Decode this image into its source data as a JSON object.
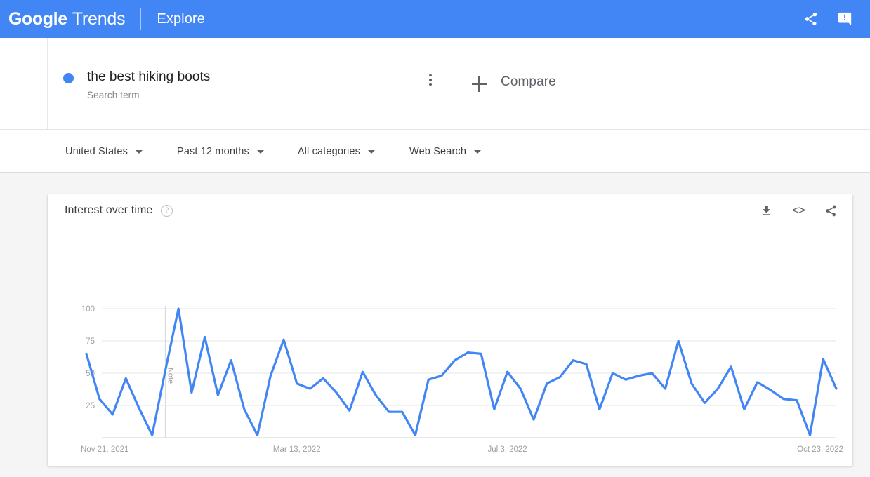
{
  "appbar": {
    "brand_google": "Google",
    "brand_trends": "Trends",
    "explore": "Explore",
    "share_icon": "share-icon",
    "feedback_icon": "feedback-icon"
  },
  "query": {
    "term": "the best hiking boots",
    "type_label": "Search term",
    "menu_icon": "more-vert-icon",
    "dot_color": "#4285f4",
    "compare_label": "Compare",
    "compare_icon": "plus-icon"
  },
  "filters": [
    {
      "label": "United States",
      "name": "filter-location"
    },
    {
      "label": "Past 12 months",
      "name": "filter-time-range"
    },
    {
      "label": "All categories",
      "name": "filter-category"
    },
    {
      "label": "Web Search",
      "name": "filter-search-type"
    }
  ],
  "chart_card": {
    "title": "Interest over time",
    "help_glyph": "?",
    "actions": [
      {
        "name": "download-icon",
        "label": "download"
      },
      {
        "name": "embed-code-icon",
        "label": "<>"
      },
      {
        "name": "share-icon",
        "label": "share"
      }
    ]
  },
  "chart_data": {
    "type": "line",
    "title": "Interest over time",
    "xlabel": "",
    "ylabel": "",
    "ylim": [
      0,
      100
    ],
    "yticks": [
      100,
      75,
      50,
      25
    ],
    "gridlines": true,
    "legend_position": "none",
    "line_color": "#4285f4",
    "x_tick_labels": [
      "Nov 21, 2021",
      "Mar 13, 2022",
      "Jul 3, 2022",
      "Oct 23, 2022"
    ],
    "x_tick_positions": [
      0,
      16,
      32,
      48
    ],
    "annotation": {
      "label": "Note",
      "x_index": 6
    },
    "series": [
      {
        "name": "the best hiking boots",
        "values": [
          65,
          30,
          18,
          46,
          23,
          2,
          52,
          100,
          35,
          78,
          33,
          60,
          22,
          2,
          48,
          76,
          42,
          38,
          46,
          35,
          21,
          51,
          33,
          20,
          20,
          2,
          45,
          48,
          60,
          66,
          65,
          22,
          51,
          38,
          14,
          42,
          47,
          60,
          57,
          22,
          50,
          45,
          48,
          50,
          38,
          75,
          42,
          27,
          38,
          55,
          22,
          43,
          37,
          30,
          29,
          2,
          61,
          38
        ]
      }
    ]
  }
}
